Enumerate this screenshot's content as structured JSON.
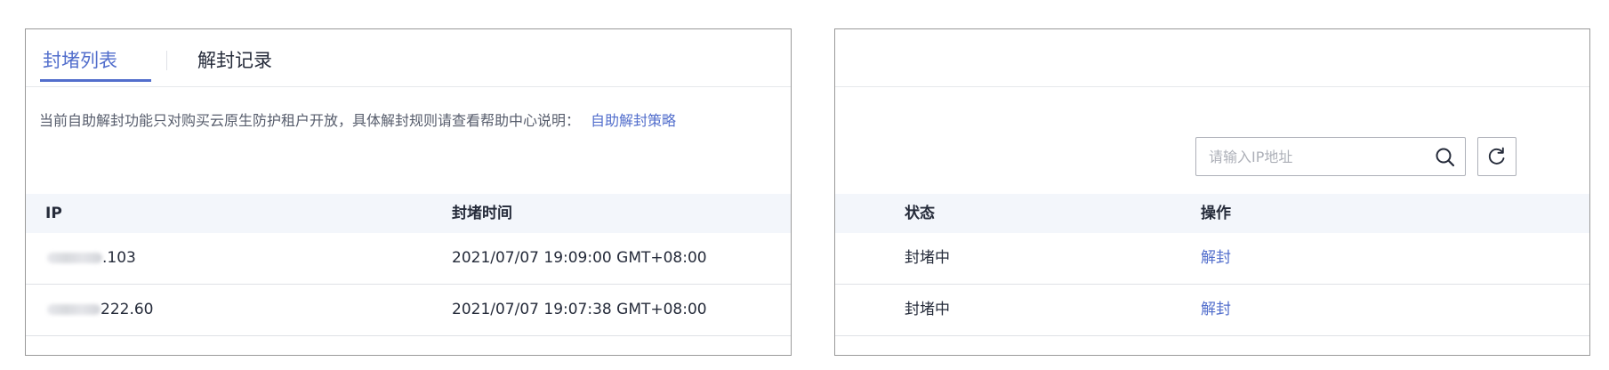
{
  "tabs": [
    {
      "label": "封堵列表",
      "active": true
    },
    {
      "label": "解封记录",
      "active": false
    }
  ],
  "notice": {
    "text": "当前自助解封功能只对购买云原生防护租户开放，具体解封规则请查看帮助中心说明：",
    "link": "自助解封策略"
  },
  "search": {
    "placeholder": "请输入IP地址",
    "value": "",
    "icon": "search-icon"
  },
  "refresh": {
    "icon": "refresh-icon"
  },
  "table": {
    "columns": [
      "IP",
      "封堵时间",
      "状态",
      "操作"
    ],
    "rows": [
      {
        "ip_visible": ".103",
        "time": "2021/07/07 19:09:00 GMT+08:00",
        "status": "封堵中",
        "action": "解封"
      },
      {
        "ip_visible": "222.60",
        "time": "2021/07/07 19:07:38 GMT+08:00",
        "status": "封堵中",
        "action": "解封"
      }
    ]
  },
  "colors": {
    "accent": "#526ecc",
    "header_bg": "#f3f6fb",
    "border": "#9a9a9a"
  }
}
